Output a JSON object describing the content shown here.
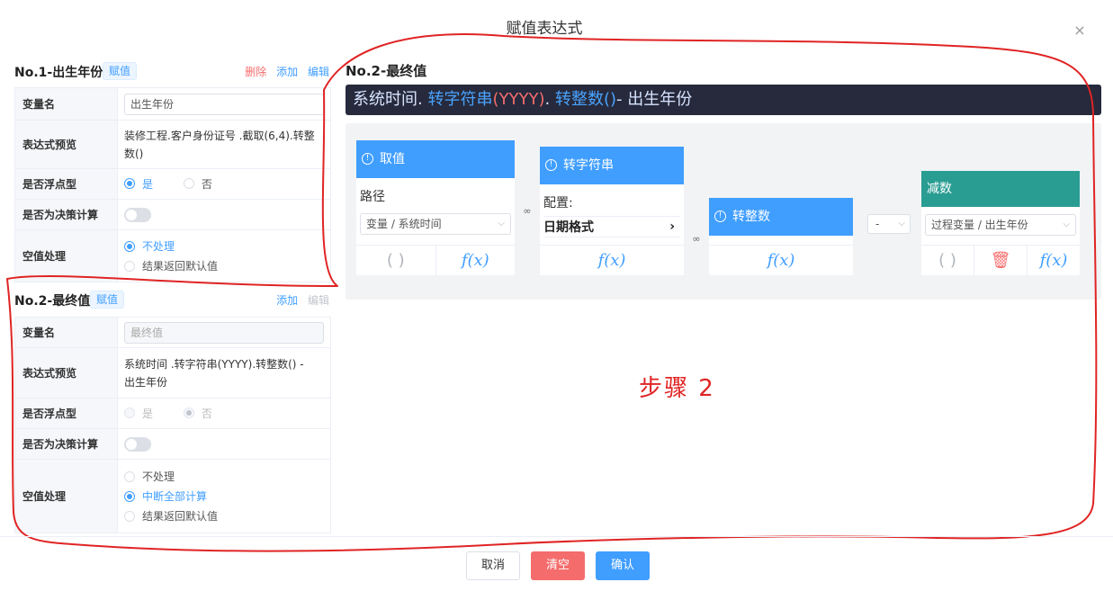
{
  "dialog": {
    "title": "赋值表达式",
    "close_glyph": "×"
  },
  "section1": {
    "title": "No.1-出生年份",
    "tag": "赋值",
    "actions": {
      "delete": "删除",
      "add": "添加",
      "edit": "编辑"
    },
    "rows": {
      "var_label": "变量名",
      "var_value": "出生年份",
      "preview_label": "表达式预览",
      "preview_value": "装修工程.客户身份证号 .截取(6,4).转整数()",
      "float_label": "是否浮点型",
      "float_yes": "是",
      "float_no": "否",
      "decision_label": "是否为决策计算",
      "null_label": "空值处理",
      "null_opt1": "不处理",
      "null_opt2": "结果返回默认值"
    }
  },
  "section2": {
    "title": "No.2-最终值",
    "tag": "赋值",
    "actions": {
      "add": "添加",
      "edit": "编辑"
    },
    "rows": {
      "var_label": "变量名",
      "var_value": "最终值",
      "preview_label": "表达式预览",
      "preview_line1": "系统时间 .转字符串(YYYY).转整数() -",
      "preview_line2": "出生年份",
      "float_label": "是否浮点型",
      "float_yes": "是",
      "float_no": "否",
      "decision_label": "是否为决策计算",
      "null_label": "空值处理",
      "null_opt1": "不处理",
      "null_opt2": "中断全部计算",
      "null_opt3": "结果返回默认值"
    }
  },
  "right": {
    "title": "No.2-最终值",
    "expression": {
      "p1": "系统时间",
      "p2": ".",
      "p3": " 转字符串",
      "p4": "(",
      "p5": "YYYY",
      "p6": ")",
      "p7": ".",
      "p8": " 转整数",
      "p9": "()",
      "p10": "- 出生年份"
    },
    "cards": {
      "c1": {
        "title": "取值",
        "label": "路径",
        "select": "变量 / 系统时间",
        "paren": "( )",
        "fx": "f(x)"
      },
      "c2": {
        "title": "转字符串",
        "label": "配置:",
        "config": "日期格式",
        "chevron": "›",
        "fx": "f(x)"
      },
      "c3": {
        "title": "转整数",
        "fx": "f(x)"
      },
      "c4": {
        "title": "减数",
        "select": "过程变量 / 出生年份",
        "paren": "( )",
        "trash": "🗑",
        "fx": "f(x)"
      }
    },
    "operator": "-",
    "info_glyph": "!",
    "link_glyph": "∞",
    "select_chevron": "⌵"
  },
  "annotation": {
    "label": "步骤 2",
    "color": "#e02424"
  },
  "footer": {
    "cancel": "取消",
    "clear": "清空",
    "confirm": "确认"
  },
  "colors": {
    "primary": "#409eff",
    "danger": "#f56c6c",
    "teal": "#2a9d93",
    "dark_bar": "#262a3c"
  }
}
